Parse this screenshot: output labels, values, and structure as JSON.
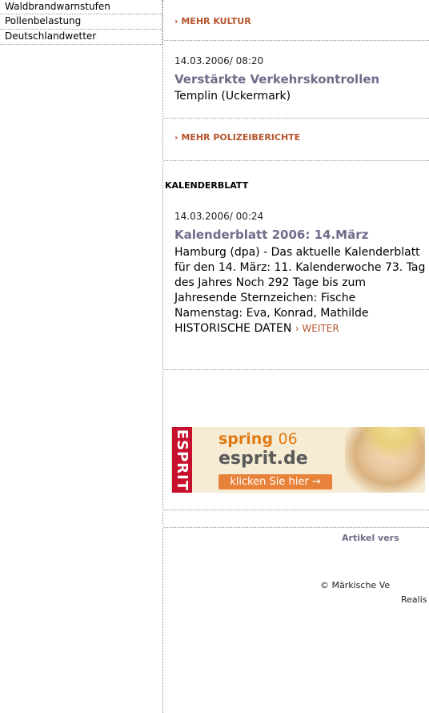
{
  "sidebar": {
    "items": [
      {
        "label": "Waldbrandwarnstufen"
      },
      {
        "label": "Pollenbelastung"
      },
      {
        "label": "Deutschlandwetter"
      }
    ]
  },
  "links": {
    "mehr_kultur": "› MEHR KULTUR",
    "mehr_polizei": "› MEHR POLIZEIBERICHTE"
  },
  "police_article": {
    "date": "14.03.2006/ 08:20",
    "headline": "Verstärkte Verkehrskontrollen",
    "place": "Templin (Uckermark)"
  },
  "calendar_section": {
    "title": "KALENDERBLATT",
    "date": "14.03.2006/ 00:24",
    "headline": "Kalenderblatt 2006: 14.März",
    "text": "Hamburg (dpa) - Das aktuelle Kalenderblatt für den 14. März: 11. Kalenderwoche 73. Tag des Jahres Noch 292 Tage bis zum Jahresende Sternzeichen: Fische Namenstag: Eva, Konrad, Mathilde HISTORISCHE DATEN",
    "weiter": "› WEITER"
  },
  "banner": {
    "brand_vertical": "ESPRIT",
    "spring": "spring",
    "spring_num": "06",
    "site": "esprit.de",
    "button": "klicken Sie hier →"
  },
  "footer": {
    "article_send": "Artikel vers",
    "copyright": "© Märkische Ve",
    "realis": "Realis"
  },
  "colors": {
    "link_orange": "#b5562f",
    "headline_gray": "#6d6d8a",
    "esprit_red": "#c8102e"
  }
}
